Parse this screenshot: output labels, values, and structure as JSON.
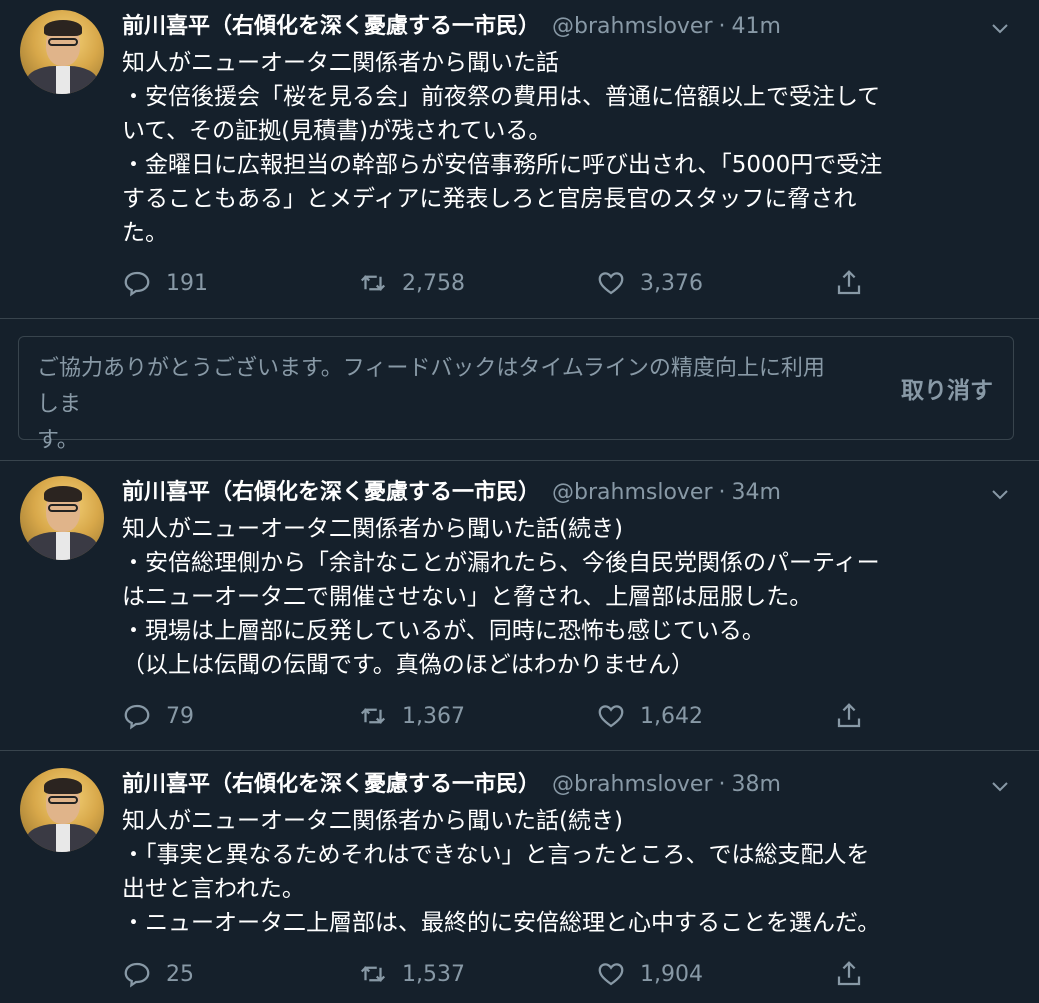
{
  "colors": {
    "background": "#15202b",
    "secondary_text": "#8899a6",
    "border": "#38444d"
  },
  "tweets": [
    {
      "name": "前川喜平（右傾化を深く憂慮する一市民）",
      "handle": "@brahmslover",
      "time": "41m",
      "text": "知人がニューオータ二関係者から聞いた話\n・安倍後援会「桜を見る会」前夜祭の費用は、普通に倍額以上で受注して\nいて、その証拠(見積書)が残されている。\n・金曜日に広報担当の幹部らが安倍事務所に呼び出され、「5000円で受注\nすることもある」とメディアに発表しろと官房長官のスタッフに脅され\nた。",
      "replies": "191",
      "retweets": "2,758",
      "likes": "3,376"
    },
    {
      "name": "前川喜平（右傾化を深く憂慮する一市民）",
      "handle": "@brahmslover",
      "time": "34m",
      "text": "知人がニューオータ二関係者から聞いた話(続き)\n・安倍総理側から「余計なことが漏れたら、今後自民党関係のパーティー\nはニューオータ二で開催させない」と脅され、上層部は屈服した。\n・現場は上層部に反発しているが、同時に恐怖も感じている。\n（以上は伝聞の伝聞です。真偽のほどはわかりません）",
      "replies": "79",
      "retweets": "1,367",
      "likes": "1,642"
    },
    {
      "name": "前川喜平（右傾化を深く憂慮する一市民）",
      "handle": "@brahmslover",
      "time": "38m",
      "text": "知人がニューオータ二関係者から聞いた話(続き)\n・「事実と異なるためそれはできない」と言ったところ、では総支配人を\n出せと言われた。\n・ニューオータ二上層部は、最終的に安倍総理と心中することを選んだ。",
      "replies": "25",
      "retweets": "1,537",
      "likes": "1,904"
    }
  ],
  "feedback": {
    "text": "ご協力ありがとうございます。フィードバックはタイムラインの精度向上に利用しま\nす。",
    "undo_label": "取り消す"
  },
  "icons": {
    "reply": "reply-icon",
    "retweet": "retweet-icon",
    "like": "like-icon",
    "share": "share-icon",
    "more": "chevron-down-icon"
  }
}
